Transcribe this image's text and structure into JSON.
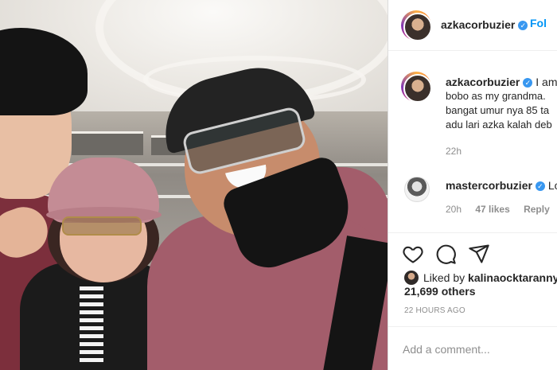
{
  "header": {
    "username": "azkacorbuzier",
    "follow_label": "Fol"
  },
  "caption": {
    "username": "azkacorbuzier",
    "start": "I am",
    "lines": [
      "bobo as my grandma.",
      "bangat umur nya 85 ta",
      "adu lari azka kalah deb"
    ],
    "time": "22h"
  },
  "comment": {
    "username": "mastercorbuzier",
    "text": "Lo",
    "time": "20h",
    "likes": "47 likes",
    "reply_label": "Reply"
  },
  "likes": {
    "prefix": "Liked by",
    "user": "kalinaocktaranny",
    "others": "21,699 others"
  },
  "posted_time": "22 HOURS AGO",
  "add_comment": {
    "placeholder": "Add a comment..."
  },
  "icons": {
    "verified": "verified-badge-icon",
    "like": "heart-icon",
    "comment": "comment-icon",
    "share": "paper-plane-icon",
    "more": "more-options-icon"
  },
  "colors": {
    "link": "#0095f6",
    "verified": "#3897f0",
    "muted": "#8e8e8e",
    "text": "#262626"
  }
}
